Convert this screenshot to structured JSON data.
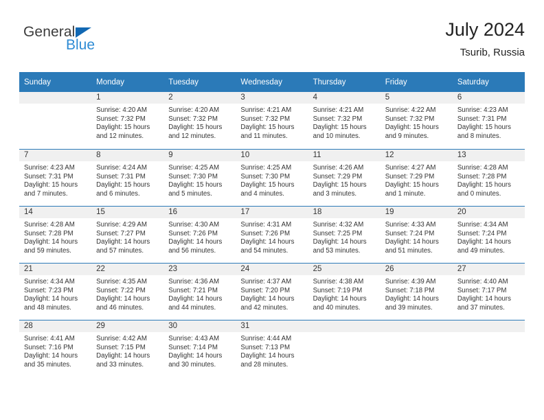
{
  "brand": {
    "name_part1": "General",
    "name_part2": "Blue",
    "accent_color": "#2e8bd4",
    "logo_triangle_color": "#1268b3"
  },
  "header": {
    "title": "July 2024",
    "subtitle": "Tsurib, Russia"
  },
  "calendar": {
    "header_background": "#2b7ab8",
    "daynum_background": "#f0f0f0",
    "weekdays": [
      "Sunday",
      "Monday",
      "Tuesday",
      "Wednesday",
      "Thursday",
      "Friday",
      "Saturday"
    ],
    "weeks": [
      [
        {
          "day": "",
          "sunrise": "",
          "sunset": "",
          "daylight1": "",
          "daylight2": "",
          "empty": true
        },
        {
          "day": "1",
          "sunrise": "Sunrise: 4:20 AM",
          "sunset": "Sunset: 7:32 PM",
          "daylight1": "Daylight: 15 hours",
          "daylight2": "and 12 minutes.",
          "empty": false
        },
        {
          "day": "2",
          "sunrise": "Sunrise: 4:20 AM",
          "sunset": "Sunset: 7:32 PM",
          "daylight1": "Daylight: 15 hours",
          "daylight2": "and 12 minutes.",
          "empty": false
        },
        {
          "day": "3",
          "sunrise": "Sunrise: 4:21 AM",
          "sunset": "Sunset: 7:32 PM",
          "daylight1": "Daylight: 15 hours",
          "daylight2": "and 11 minutes.",
          "empty": false
        },
        {
          "day": "4",
          "sunrise": "Sunrise: 4:21 AM",
          "sunset": "Sunset: 7:32 PM",
          "daylight1": "Daylight: 15 hours",
          "daylight2": "and 10 minutes.",
          "empty": false
        },
        {
          "day": "5",
          "sunrise": "Sunrise: 4:22 AM",
          "sunset": "Sunset: 7:32 PM",
          "daylight1": "Daylight: 15 hours",
          "daylight2": "and 9 minutes.",
          "empty": false
        },
        {
          "day": "6",
          "sunrise": "Sunrise: 4:23 AM",
          "sunset": "Sunset: 7:31 PM",
          "daylight1": "Daylight: 15 hours",
          "daylight2": "and 8 minutes.",
          "empty": false
        }
      ],
      [
        {
          "day": "7",
          "sunrise": "Sunrise: 4:23 AM",
          "sunset": "Sunset: 7:31 PM",
          "daylight1": "Daylight: 15 hours",
          "daylight2": "and 7 minutes.",
          "empty": false
        },
        {
          "day": "8",
          "sunrise": "Sunrise: 4:24 AM",
          "sunset": "Sunset: 7:31 PM",
          "daylight1": "Daylight: 15 hours",
          "daylight2": "and 6 minutes.",
          "empty": false
        },
        {
          "day": "9",
          "sunrise": "Sunrise: 4:25 AM",
          "sunset": "Sunset: 7:30 PM",
          "daylight1": "Daylight: 15 hours",
          "daylight2": "and 5 minutes.",
          "empty": false
        },
        {
          "day": "10",
          "sunrise": "Sunrise: 4:25 AM",
          "sunset": "Sunset: 7:30 PM",
          "daylight1": "Daylight: 15 hours",
          "daylight2": "and 4 minutes.",
          "empty": false
        },
        {
          "day": "11",
          "sunrise": "Sunrise: 4:26 AM",
          "sunset": "Sunset: 7:29 PM",
          "daylight1": "Daylight: 15 hours",
          "daylight2": "and 3 minutes.",
          "empty": false
        },
        {
          "day": "12",
          "sunrise": "Sunrise: 4:27 AM",
          "sunset": "Sunset: 7:29 PM",
          "daylight1": "Daylight: 15 hours",
          "daylight2": "and 1 minute.",
          "empty": false
        },
        {
          "day": "13",
          "sunrise": "Sunrise: 4:28 AM",
          "sunset": "Sunset: 7:28 PM",
          "daylight1": "Daylight: 15 hours",
          "daylight2": "and 0 minutes.",
          "empty": false
        }
      ],
      [
        {
          "day": "14",
          "sunrise": "Sunrise: 4:28 AM",
          "sunset": "Sunset: 7:28 PM",
          "daylight1": "Daylight: 14 hours",
          "daylight2": "and 59 minutes.",
          "empty": false
        },
        {
          "day": "15",
          "sunrise": "Sunrise: 4:29 AM",
          "sunset": "Sunset: 7:27 PM",
          "daylight1": "Daylight: 14 hours",
          "daylight2": "and 57 minutes.",
          "empty": false
        },
        {
          "day": "16",
          "sunrise": "Sunrise: 4:30 AM",
          "sunset": "Sunset: 7:26 PM",
          "daylight1": "Daylight: 14 hours",
          "daylight2": "and 56 minutes.",
          "empty": false
        },
        {
          "day": "17",
          "sunrise": "Sunrise: 4:31 AM",
          "sunset": "Sunset: 7:26 PM",
          "daylight1": "Daylight: 14 hours",
          "daylight2": "and 54 minutes.",
          "empty": false
        },
        {
          "day": "18",
          "sunrise": "Sunrise: 4:32 AM",
          "sunset": "Sunset: 7:25 PM",
          "daylight1": "Daylight: 14 hours",
          "daylight2": "and 53 minutes.",
          "empty": false
        },
        {
          "day": "19",
          "sunrise": "Sunrise: 4:33 AM",
          "sunset": "Sunset: 7:24 PM",
          "daylight1": "Daylight: 14 hours",
          "daylight2": "and 51 minutes.",
          "empty": false
        },
        {
          "day": "20",
          "sunrise": "Sunrise: 4:34 AM",
          "sunset": "Sunset: 7:24 PM",
          "daylight1": "Daylight: 14 hours",
          "daylight2": "and 49 minutes.",
          "empty": false
        }
      ],
      [
        {
          "day": "21",
          "sunrise": "Sunrise: 4:34 AM",
          "sunset": "Sunset: 7:23 PM",
          "daylight1": "Daylight: 14 hours",
          "daylight2": "and 48 minutes.",
          "empty": false
        },
        {
          "day": "22",
          "sunrise": "Sunrise: 4:35 AM",
          "sunset": "Sunset: 7:22 PM",
          "daylight1": "Daylight: 14 hours",
          "daylight2": "and 46 minutes.",
          "empty": false
        },
        {
          "day": "23",
          "sunrise": "Sunrise: 4:36 AM",
          "sunset": "Sunset: 7:21 PM",
          "daylight1": "Daylight: 14 hours",
          "daylight2": "and 44 minutes.",
          "empty": false
        },
        {
          "day": "24",
          "sunrise": "Sunrise: 4:37 AM",
          "sunset": "Sunset: 7:20 PM",
          "daylight1": "Daylight: 14 hours",
          "daylight2": "and 42 minutes.",
          "empty": false
        },
        {
          "day": "25",
          "sunrise": "Sunrise: 4:38 AM",
          "sunset": "Sunset: 7:19 PM",
          "daylight1": "Daylight: 14 hours",
          "daylight2": "and 40 minutes.",
          "empty": false
        },
        {
          "day": "26",
          "sunrise": "Sunrise: 4:39 AM",
          "sunset": "Sunset: 7:18 PM",
          "daylight1": "Daylight: 14 hours",
          "daylight2": "and 39 minutes.",
          "empty": false
        },
        {
          "day": "27",
          "sunrise": "Sunrise: 4:40 AM",
          "sunset": "Sunset: 7:17 PM",
          "daylight1": "Daylight: 14 hours",
          "daylight2": "and 37 minutes.",
          "empty": false
        }
      ],
      [
        {
          "day": "28",
          "sunrise": "Sunrise: 4:41 AM",
          "sunset": "Sunset: 7:16 PM",
          "daylight1": "Daylight: 14 hours",
          "daylight2": "and 35 minutes.",
          "empty": false
        },
        {
          "day": "29",
          "sunrise": "Sunrise: 4:42 AM",
          "sunset": "Sunset: 7:15 PM",
          "daylight1": "Daylight: 14 hours",
          "daylight2": "and 33 minutes.",
          "empty": false
        },
        {
          "day": "30",
          "sunrise": "Sunrise: 4:43 AM",
          "sunset": "Sunset: 7:14 PM",
          "daylight1": "Daylight: 14 hours",
          "daylight2": "and 30 minutes.",
          "empty": false
        },
        {
          "day": "31",
          "sunrise": "Sunrise: 4:44 AM",
          "sunset": "Sunset: 7:13 PM",
          "daylight1": "Daylight: 14 hours",
          "daylight2": "and 28 minutes.",
          "empty": false
        },
        {
          "day": "",
          "sunrise": "",
          "sunset": "",
          "daylight1": "",
          "daylight2": "",
          "empty": true
        },
        {
          "day": "",
          "sunrise": "",
          "sunset": "",
          "daylight1": "",
          "daylight2": "",
          "empty": true
        },
        {
          "day": "",
          "sunrise": "",
          "sunset": "",
          "daylight1": "",
          "daylight2": "",
          "empty": true
        }
      ]
    ]
  }
}
